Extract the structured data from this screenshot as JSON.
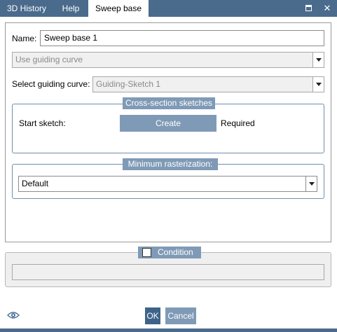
{
  "tabs": [
    {
      "label": "3D History",
      "active": false
    },
    {
      "label": "Help",
      "active": false
    },
    {
      "label": "Sweep base",
      "active": true
    }
  ],
  "window": {
    "restore_icon": "restore-icon",
    "close_icon": "close-icon",
    "close_glyph": "✕"
  },
  "form": {
    "name_label": "Name:",
    "name_value": "Sweep base 1",
    "mode_select": "Use guiding curve",
    "guiding_curve_label": "Select guiding curve:",
    "guiding_curve_value": "Guiding-Sketch 1"
  },
  "cross_section": {
    "title": "Cross-section sketches",
    "start_sketch_label": "Start sketch:",
    "create_button": "Create",
    "status": "Required"
  },
  "rasterization": {
    "title": "Minimum rasterization:",
    "value": "Default"
  },
  "condition": {
    "label": "Condition",
    "checked": false,
    "value": ""
  },
  "footer": {
    "visibility_icon": "eye-icon",
    "ok_label": "OK",
    "cancel_label": "Cancel"
  },
  "colors": {
    "tab_bar": "#4a6b8c",
    "accent": "#7f9ab6",
    "group_border": "#6f8fae"
  }
}
